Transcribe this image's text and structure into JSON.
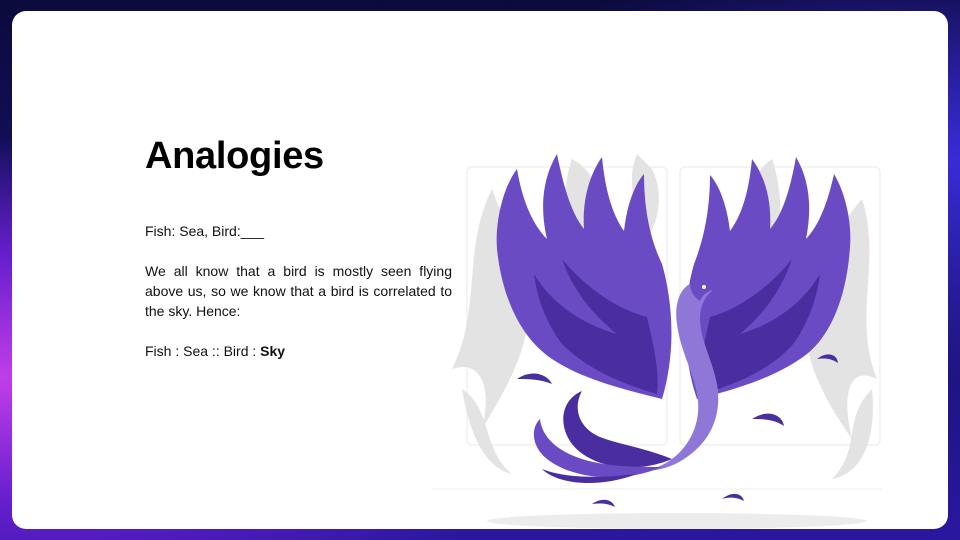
{
  "slide": {
    "title": "Analogies",
    "question": "Fish: Sea, Bird:___",
    "explanation": "We all know that a bird is mostly seen flying above us, so we know that a bird is correlated to the sky. Hence:",
    "answer_prefix": "Fish : Sea :: Bird : ",
    "answer": "Sky"
  },
  "illustration": {
    "icon": "phoenix-icon",
    "primary_color": "#6b4bc4",
    "secondary_color": "#4a2ea0",
    "highlight_color": "#8e77d6",
    "backdrop_color": "#e2e2e2"
  }
}
